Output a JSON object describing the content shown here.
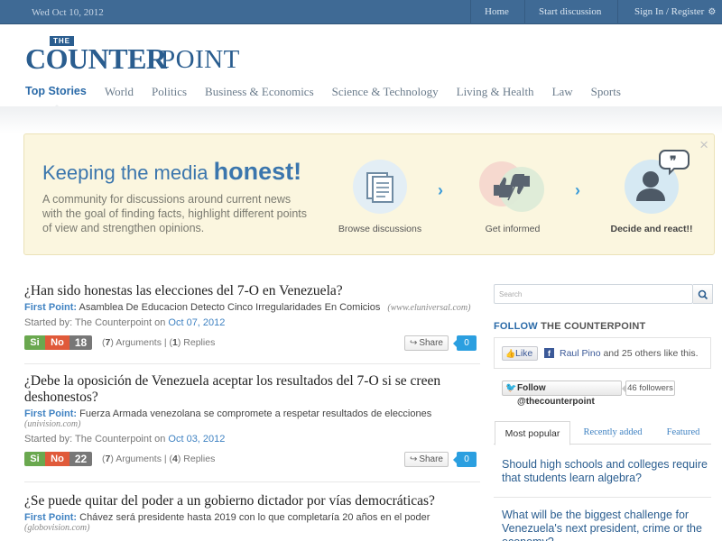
{
  "topbar": {
    "date": "Wed Oct 10, 2012",
    "nav": {
      "home": "Home",
      "start": "Start discussion",
      "signin": "Sign In / Register"
    }
  },
  "logo": {
    "the": "THE",
    "counter": "COUNTER",
    "point": "POINT"
  },
  "categories": [
    "Top Stories",
    "World",
    "Politics",
    "Business & Economics",
    "Science & Technology",
    "Living & Health",
    "Law",
    "Sports"
  ],
  "hero": {
    "title_prefix": "Keeping the media",
    "title_emphasis": "honest!",
    "description": "A community for discussions around current news with the goal of finding facts, highlight different points of view and strengthen opinions.",
    "close": "×",
    "steps": [
      "Browse discussions",
      "Get informed",
      "Decide and react!!"
    ]
  },
  "articles": [
    {
      "title": "¿Han sido honestas las elecciones del 7-O en Venezuela?",
      "first_point_label": "First Point:",
      "first_point": "Asamblea De Educacion Detecto Cinco Irregularidades En Comicios",
      "source": "(www.eluniversal.com)",
      "started_label": "Started by: The Counterpoint on",
      "date": "Oct 07, 2012",
      "si": "Si",
      "no": "No",
      "count": "18",
      "arguments": "7",
      "arguments_label": "Arguments",
      "replies": "1",
      "replies_label": "Replies",
      "share": "Share",
      "share_count": "0"
    },
    {
      "title": "¿Debe la oposición de Venezuela aceptar los resultados del 7-O si se creen deshonestos?",
      "first_point_label": "First Point:",
      "first_point": "Fuerza Armada venezolana se compromete a respetar resultados de elecciones",
      "source": "(univision.com)",
      "started_label": "Started by: The Counterpoint on",
      "date": "Oct 03, 2012",
      "si": "Si",
      "no": "No",
      "count": "22",
      "arguments": "7",
      "arguments_label": "Arguments",
      "replies": "4",
      "replies_label": "Replies",
      "share": "Share",
      "share_count": "0"
    },
    {
      "title": "¿Se puede quitar del poder a un gobierno dictador por vías democráticas?",
      "first_point_label": "First Point:",
      "first_point": "Chávez será presidente hasta 2019 con lo que completaría 20 años en el poder",
      "source": "(globovision.com)"
    }
  ],
  "sidebar": {
    "search_placeholder": "Search",
    "follow_title_prefix": "FOLLOW",
    "follow_title_name": "THE COUNTERPOINT",
    "like_label": "Like",
    "fb_name": "Raul Pino",
    "fb_text": "and 25 others like this.",
    "twitter_label": "Follow @thecounterpoint",
    "twitter_followers": "46 followers",
    "tabs": [
      "Most popular",
      "Recently added",
      "Featured"
    ],
    "popular": [
      "Should high schools and colleges require that students learn algebra?",
      "What will be the biggest challenge for Venezuela's next president, crime or the economy?"
    ]
  },
  "colors": {
    "topbar": "#3f6a95",
    "brand_blue": "#2a5d8f",
    "link_blue": "#3f82c2",
    "hero_bg": "#fbf6df",
    "vote_si": "#6aa84f",
    "vote_no": "#e05a3a",
    "share_count": "#2b9fe0"
  },
  "icons": [
    "gear-icon",
    "close-icon",
    "document-icon",
    "thumbs-icon",
    "person-speech-icon",
    "chevron-right-icon",
    "share-icon",
    "search-icon",
    "like-thumb-icon",
    "facebook-icon",
    "twitter-bird-icon"
  ]
}
